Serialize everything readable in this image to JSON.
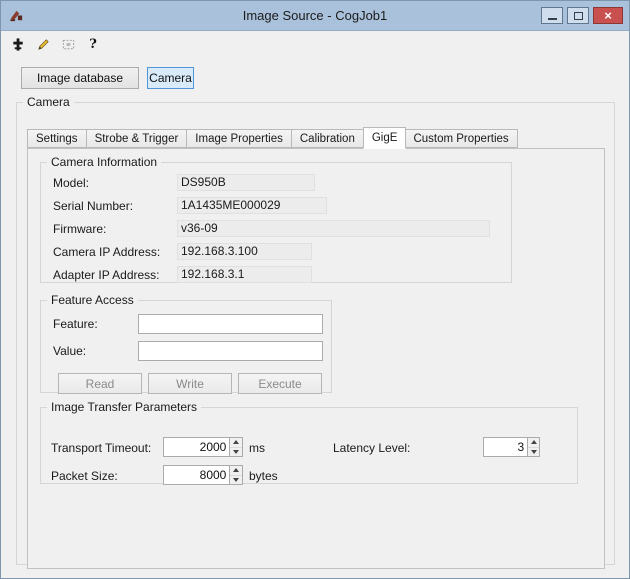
{
  "window": {
    "title": "Image Source - CogJob1"
  },
  "toolbar": {
    "icons": [
      {
        "name": "camera-connector-icon"
      },
      {
        "name": "pen-edit-icon"
      },
      {
        "name": "region-select-icon"
      },
      {
        "name": "help-icon"
      }
    ],
    "help_glyph": "?"
  },
  "source_selector": {
    "image_database_label": "Image database",
    "camera_label": "Camera"
  },
  "camera_group_label": "Camera",
  "tabs": [
    {
      "label": "Settings"
    },
    {
      "label": "Strobe & Trigger"
    },
    {
      "label": "Image Properties"
    },
    {
      "label": "Calibration"
    },
    {
      "label": "GigE"
    },
    {
      "label": "Custom Properties"
    }
  ],
  "selected_tab": "GigE",
  "camera_information": {
    "title": "Camera Information",
    "fields": [
      {
        "label": "Model:",
        "value": "DS950B"
      },
      {
        "label": "Serial Number:",
        "value": "1A1435ME000029"
      },
      {
        "label": "Firmware:",
        "value": "v36-09"
      },
      {
        "label": "Camera IP Address:",
        "value": "192.168.3.100"
      },
      {
        "label": "Adapter IP Address:",
        "value": "192.168.3.1"
      }
    ]
  },
  "feature_access": {
    "title": "Feature Access",
    "feature_label": "Feature:",
    "feature_value": "",
    "value_label": "Value:",
    "value_value": "",
    "read_label": "Read",
    "write_label": "Write",
    "execute_label": "Execute"
  },
  "image_transfer": {
    "title": "Image Transfer Parameters",
    "transport_timeout_label": "Transport Timeout:",
    "transport_timeout_value": "2000",
    "transport_timeout_unit": "ms",
    "packet_size_label": "Packet Size:",
    "packet_size_value": "8000",
    "packet_size_unit": "bytes",
    "latency_level_label": "Latency Level:",
    "latency_level_value": "3"
  }
}
